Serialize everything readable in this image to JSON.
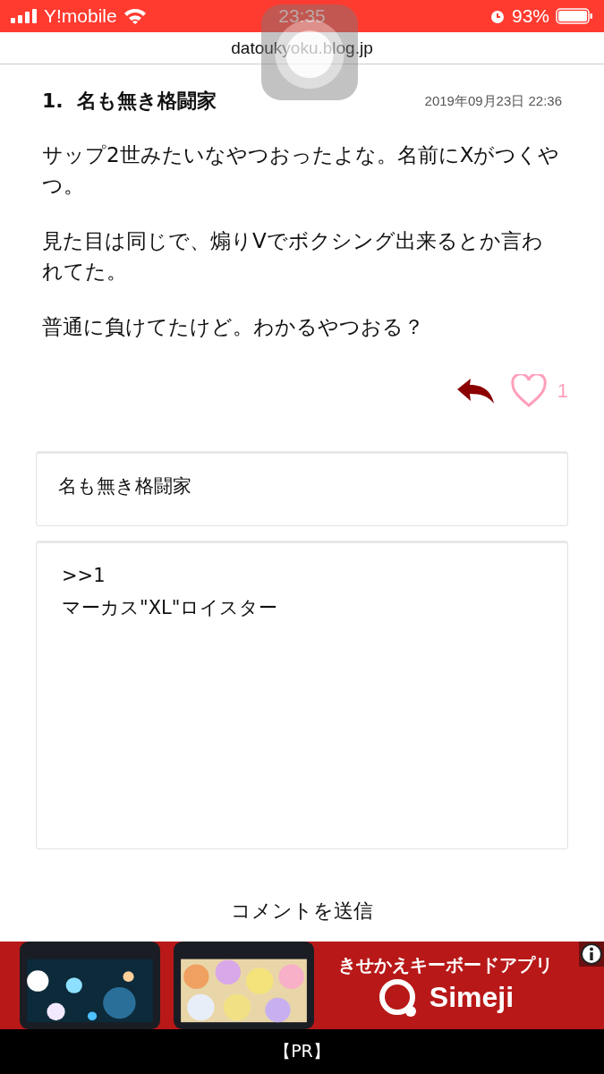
{
  "status_bar": {
    "carrier": "Y!mobile",
    "time": "23:35",
    "battery": "93%"
  },
  "address_bar": {
    "url": "datoukyoku.blog.jp"
  },
  "comment": {
    "number": "1.",
    "author": "名も無き格闘家",
    "date": "2019年09月23日 22:36",
    "paragraphs": [
      "サップ2世みたいなやつおったよな。名前にXがつくやつ。",
      "見た目は同じで、煽りVでボクシング出来るとか言われてた。",
      "普通に負けてたけど。わかるやつおる？"
    ],
    "likes": "1"
  },
  "form": {
    "name": "名も無き格闘家",
    "body": ">>1\nマーカス\"XL\"ロイスター",
    "submit": "コメントを送信"
  },
  "ad": {
    "headline": "きせかえキーボードアプリ",
    "brand": "Simeji",
    "label": "【PR】"
  }
}
